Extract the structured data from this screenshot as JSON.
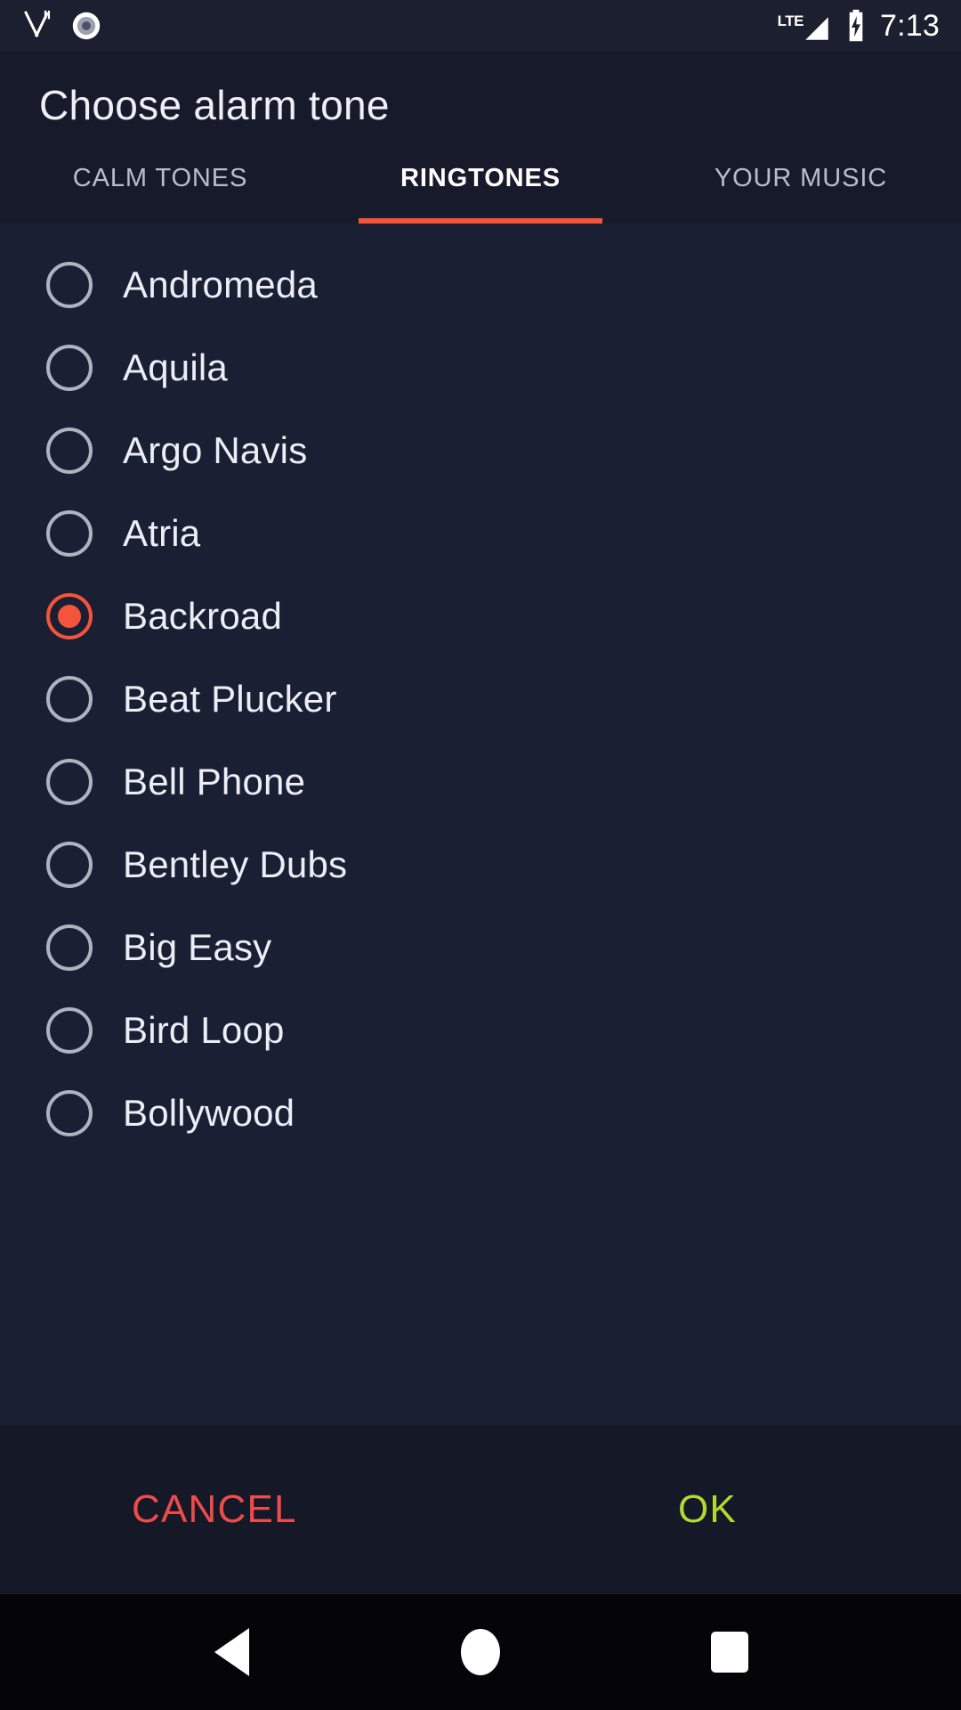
{
  "status_bar": {
    "icons_left": [
      {
        "name": "cutlery-icon",
        "label": "restaurant"
      },
      {
        "name": "disc-icon",
        "label": "record"
      }
    ],
    "network_label": "LTE",
    "signal_icon": "signal-triangle-icon",
    "battery_icon": "battery-charging-icon",
    "time": "7:13"
  },
  "header": {
    "title": "Choose alarm tone"
  },
  "tabs": [
    {
      "label": "CALM TONES",
      "active": false
    },
    {
      "label": "RINGTONES",
      "active": true
    },
    {
      "label": "YOUR MUSIC",
      "active": false
    }
  ],
  "tones": [
    {
      "label": "Andromeda",
      "selected": false
    },
    {
      "label": "Aquila",
      "selected": false
    },
    {
      "label": "Argo Navis",
      "selected": false
    },
    {
      "label": "Atria",
      "selected": false
    },
    {
      "label": "Backroad",
      "selected": true
    },
    {
      "label": "Beat Plucker",
      "selected": false
    },
    {
      "label": "Bell Phone",
      "selected": false
    },
    {
      "label": "Bentley Dubs",
      "selected": false
    },
    {
      "label": "Big Easy",
      "selected": false
    },
    {
      "label": "Bird Loop",
      "selected": false
    },
    {
      "label": "Bollywood",
      "selected": false
    }
  ],
  "actions": {
    "cancel_label": "CANCEL",
    "ok_label": "OK"
  },
  "nav_bar": {
    "back": "back-icon",
    "home": "home-icon",
    "recents": "recents-icon"
  },
  "colors": {
    "accent": "#f4543c",
    "cancel": "#ef4b4b",
    "ok": "#b2d930",
    "status_bar_bg": "#1b1f30",
    "header_bg": "#161a2b",
    "list_bg": "#1a1f33",
    "action_bg": "#141827",
    "nav_bg": "#050507",
    "radio_stroke": "#aeb3c2",
    "text_primary": "#eceef5",
    "text_inactive": "#b9bdcb"
  }
}
